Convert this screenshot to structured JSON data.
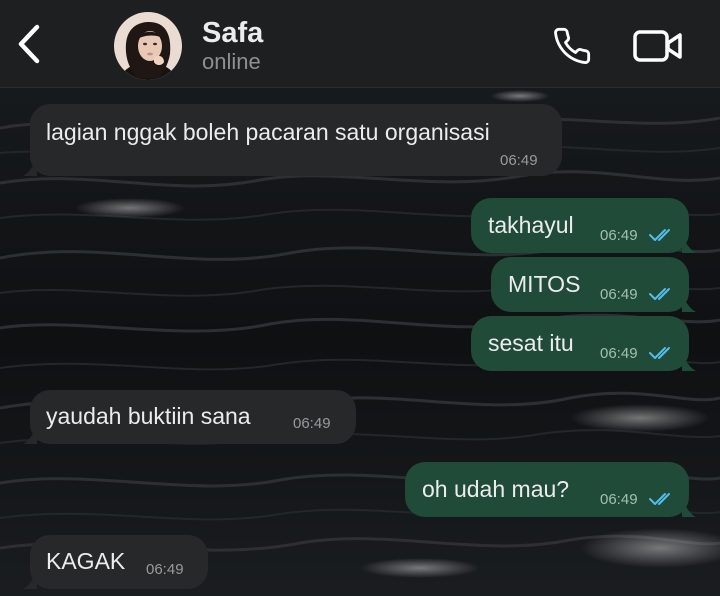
{
  "header": {
    "contact_name": "Safa",
    "status": "online",
    "icons": {
      "back": "chevron-left-icon",
      "call": "phone-icon",
      "video": "video-camera-icon"
    }
  },
  "messages": [
    {
      "direction": "incoming",
      "text": "lagian nggak boleh pacaran satu organisasi",
      "time": "06:49"
    },
    {
      "direction": "outgoing",
      "text": "takhayul",
      "time": "06:49",
      "status": "read"
    },
    {
      "direction": "outgoing",
      "text": "MITOS",
      "time": "06:49",
      "status": "read"
    },
    {
      "direction": "outgoing",
      "text": "sesat itu",
      "time": "06:49",
      "status": "read"
    },
    {
      "direction": "incoming",
      "text": "yaudah buktiin sana",
      "time": "06:49"
    },
    {
      "direction": "outgoing",
      "text": "oh udah mau?",
      "time": "06:49",
      "status": "read"
    },
    {
      "direction": "incoming",
      "text": "KAGAK",
      "time": "06:49"
    }
  ],
  "colors": {
    "header_bg": "#1e1f20",
    "incoming_bubble": "#26282a",
    "outgoing_bubble": "#1f4b38",
    "read_ticks": "#53bdeb",
    "text": "#ececec"
  }
}
